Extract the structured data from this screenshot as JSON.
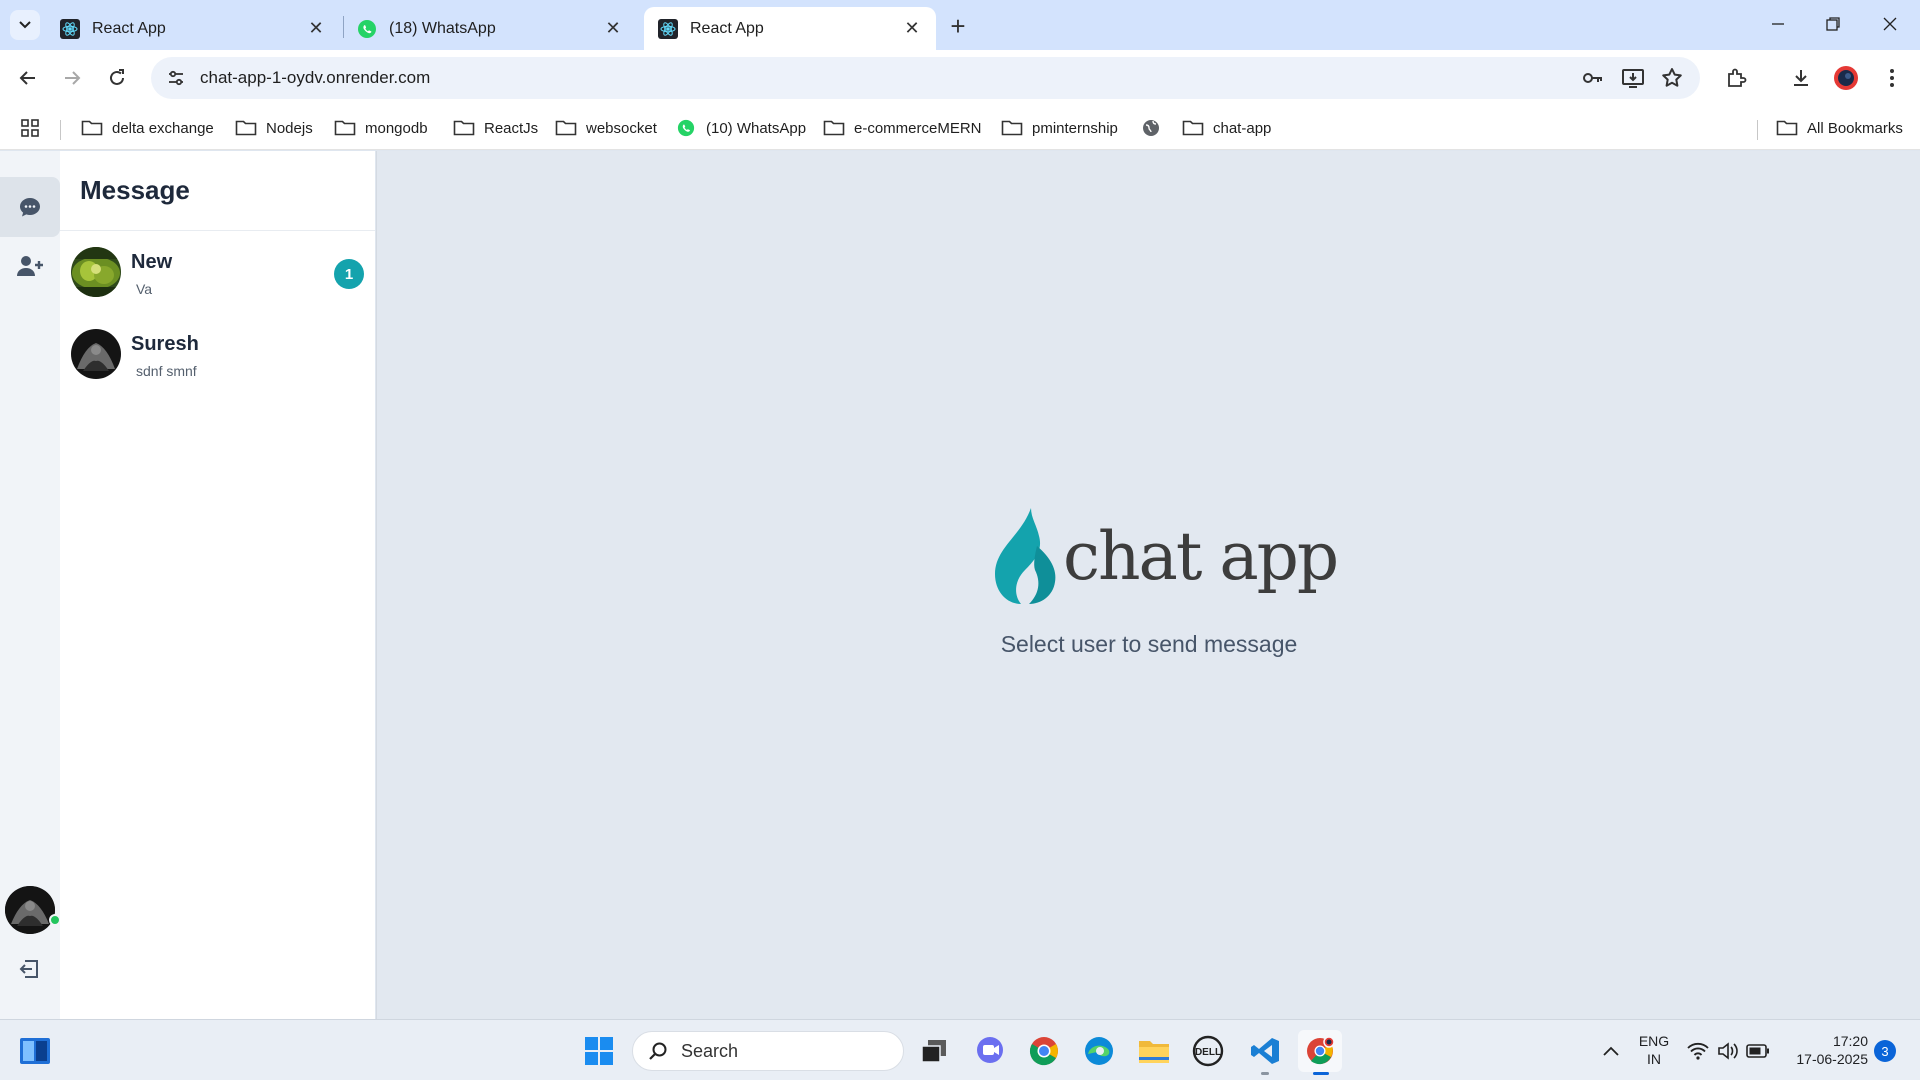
{
  "browser": {
    "tabs": [
      {
        "title": "React App",
        "icon": "react-icon",
        "active": false
      },
      {
        "title": "(18) WhatsApp",
        "icon": "whatsapp-icon",
        "active": false
      },
      {
        "title": "React App",
        "icon": "react-icon",
        "active": true
      }
    ],
    "url": "chat-app-1-oydv.onrender.com",
    "bookmarks": [
      {
        "label": "delta exchange",
        "icon": "folder-icon"
      },
      {
        "label": "Nodejs",
        "icon": "folder-icon"
      },
      {
        "label": "mongodb",
        "icon": "folder-icon"
      },
      {
        "label": "ReactJs",
        "icon": "folder-icon"
      },
      {
        "label": "websocket",
        "icon": "folder-icon"
      },
      {
        "label": "(10) WhatsApp",
        "icon": "whatsapp-icon"
      },
      {
        "label": "e-commerceMERN",
        "icon": "folder-icon"
      },
      {
        "label": "pminternship",
        "icon": "folder-icon"
      },
      {
        "label": "",
        "icon": "globe-icon"
      },
      {
        "label": "chat-app",
        "icon": "folder-icon"
      }
    ],
    "all_bookmarks": "All Bookmarks"
  },
  "app": {
    "sidebar_title": "Message",
    "conversations": [
      {
        "name": "New",
        "last_message": "Va",
        "unread": "1"
      },
      {
        "name": "Suresh",
        "last_message": "sdnf smnf",
        "unread": ""
      }
    ],
    "logo_text": "chat app",
    "empty_hint": "Select user to send message",
    "brand_color": "#14a3ad"
  },
  "taskbar": {
    "search_placeholder": "Search",
    "language": "ENG",
    "region": "IN",
    "time": "17:20",
    "date": "17-06-2025",
    "notifications": "3"
  }
}
